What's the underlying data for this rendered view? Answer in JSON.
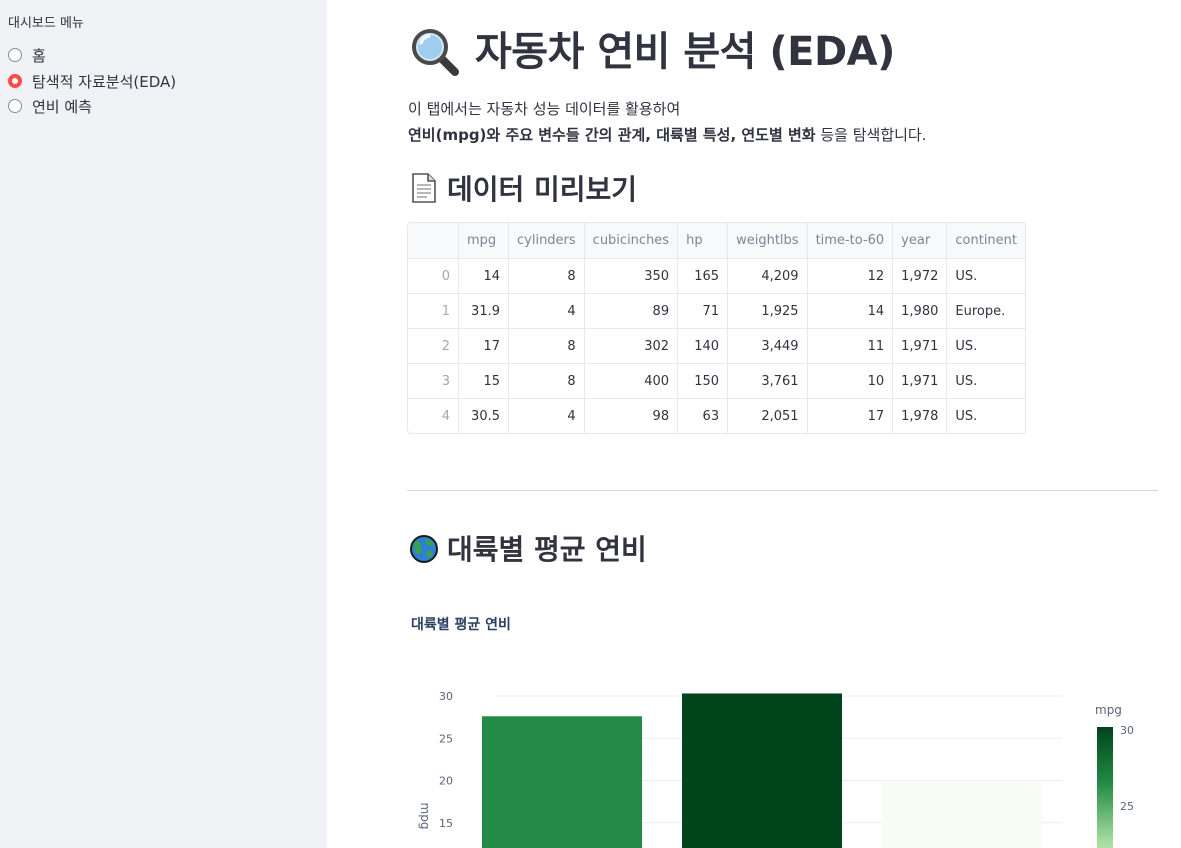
{
  "sidebar": {
    "title": "대시보드 메뉴",
    "options": [
      "홈",
      "탐색적 자료분석(EDA)",
      "연비 예측"
    ],
    "selected_index": 1
  },
  "main": {
    "title": "자동차 연비 분석 (EDA)",
    "title_icon": "magnifying-glass-icon",
    "intro_line1": "이 탭에서는 자동차 성능 데이터를 활용하여",
    "intro_bold1": "연비(mpg)와 주요 변수들 간의 관계, 대륙별 특성, 연도별 변화",
    "intro_tail": " 등을 탐색합니다.",
    "preview_heading": "데이터 미리보기",
    "preview_icon": "document-icon",
    "continent_heading": "대륙별 평균 연비",
    "continent_icon": "globe-icon"
  },
  "table": {
    "columns": [
      "",
      "mpg",
      "cylinders",
      "cubicinches",
      "hp",
      "weightlbs",
      "time-to-60",
      "year",
      "continent"
    ],
    "rows": [
      [
        "0",
        "14",
        "8",
        "350",
        "165",
        "4,209",
        "12",
        "1,972",
        "US."
      ],
      [
        "1",
        "31.9",
        "4",
        "89",
        "71",
        "1,925",
        "14",
        "1,980",
        "Europe."
      ],
      [
        "2",
        "17",
        "8",
        "302",
        "140",
        "3,449",
        "11",
        "1,971",
        "US."
      ],
      [
        "3",
        "15",
        "8",
        "400",
        "150",
        "3,761",
        "10",
        "1,971",
        "US."
      ],
      [
        "4",
        "30.5",
        "4",
        "98",
        "63",
        "2,051",
        "17",
        "1,978",
        "US."
      ]
    ]
  },
  "chart_data": {
    "type": "bar",
    "title": "대륙별 평균 연비",
    "xlabel": "",
    "ylabel": "mpg",
    "values": [
      27.6,
      30.3,
      19.8
    ],
    "colors": [
      "#238b45",
      "#00441b",
      "#f7fcf5"
    ],
    "y_ticks": [
      15,
      20,
      25,
      30
    ],
    "ylim": [
      10,
      31.5
    ],
    "grid": true,
    "colorbar": {
      "title": "mpg",
      "ticks": [
        30,
        25
      ],
      "range": [
        19.8,
        30.3
      ]
    }
  },
  "colors": {
    "accent": "#ff4b4b",
    "sidebar_bg": "#f0f2f6",
    "text": "#31333f"
  }
}
